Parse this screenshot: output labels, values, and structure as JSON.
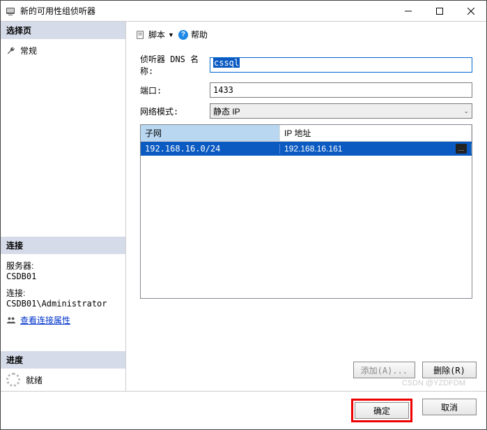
{
  "title": "新的可用性组侦听器",
  "left": {
    "select_page": "选择页",
    "general": "常规",
    "connection_head": "连接",
    "server_label": "服务器:",
    "server_value": "CSDB01",
    "conn_label": "连接:",
    "conn_value": "CSDB01\\Administrator",
    "view_props": "查看连接属性",
    "progress_head": "进度",
    "progress_status": "就绪"
  },
  "toolbar": {
    "script": "脚本",
    "help": "帮助"
  },
  "form": {
    "dns_label": "侦听器 DNS 名称:",
    "dns_value": "cssql",
    "port_label": "端口:",
    "port_value": "1433",
    "netmode_label": "网络模式:",
    "netmode_value": "静态 IP"
  },
  "table": {
    "col_subnet": "子网",
    "col_ip": "IP 地址",
    "rows": [
      {
        "subnet": "192.168.16.0/24",
        "ip": "192.168.16.161"
      }
    ]
  },
  "buttons": {
    "add": "添加(A)...",
    "remove": "删除(R)",
    "ok": "确定",
    "cancel": "取消"
  },
  "watermark": "CSDN @YZDFDM"
}
